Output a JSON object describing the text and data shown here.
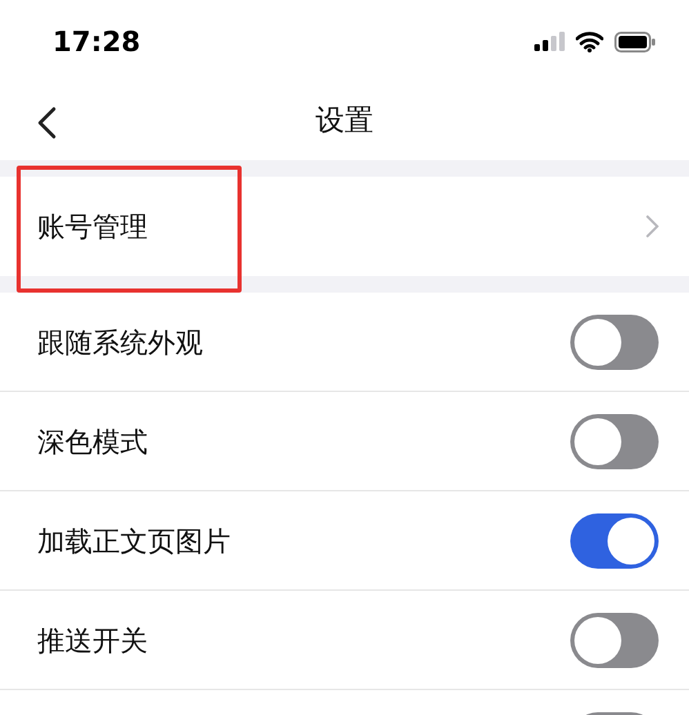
{
  "status_bar": {
    "time": "17:28"
  },
  "nav": {
    "title": "设置"
  },
  "account_row": {
    "label": "账号管理",
    "highlighted": true
  },
  "toggles": [
    {
      "label": "跟随系统外观",
      "on": false
    },
    {
      "label": "深色模式",
      "on": false
    },
    {
      "label": "加载正文页图片",
      "on": true
    },
    {
      "label": "推送开关",
      "on": false
    },
    {
      "on": false
    }
  ]
}
